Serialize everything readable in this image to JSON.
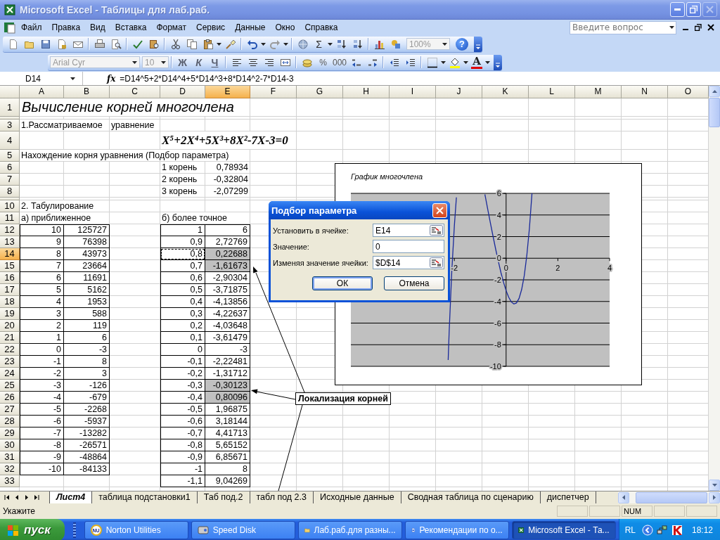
{
  "window": {
    "title": "Microsoft Excel - Таблицы для лаб.раб.",
    "controls": [
      {
        "kind": "minimize",
        "disabled": false
      },
      {
        "kind": "restore",
        "disabled": false
      },
      {
        "kind": "close",
        "disabled": true
      }
    ]
  },
  "menu": [
    "Файл",
    "Правка",
    "Вид",
    "Вставка",
    "Формат",
    "Сервис",
    "Данные",
    "Окно",
    "Справка"
  ],
  "help_box": {
    "placeholder": "Введите вопрос"
  },
  "standard_toolbar": {
    "sum": "Σ",
    "zoom": "100%",
    "help": "?"
  },
  "formatting_toolbar": {
    "font": "Arial Cyr",
    "size": "10",
    "bold": "Ж",
    "italic": "К",
    "underline": "Ч",
    "percent": "%",
    "thousands": "000",
    "font_color": "A"
  },
  "formula_bar": {
    "cell": "D14",
    "function_label": "fx",
    "formula": "=D14^5+2*D14^4+5*D14^3+8*D14^2-7*D14-3"
  },
  "sheet": {
    "columns": [
      {
        "label": "A",
        "selected": false
      },
      {
        "label": "B",
        "selected": false
      },
      {
        "label": "C",
        "selected": false
      },
      {
        "label": "D",
        "selected": false
      },
      {
        "label": "E",
        "selected": true
      },
      {
        "label": "F",
        "selected": false
      },
      {
        "label": "G",
        "selected": false
      },
      {
        "label": "H",
        "selected": false
      },
      {
        "label": "I",
        "selected": false
      },
      {
        "label": "J",
        "selected": false
      },
      {
        "label": "K",
        "selected": false
      },
      {
        "label": "L",
        "selected": false
      },
      {
        "label": "M",
        "selected": false
      },
      {
        "label": "N",
        "selected": false
      },
      {
        "label": "O",
        "selected": false
      }
    ],
    "rows": [
      {
        "header": "1",
        "kind": "tall",
        "selected": false,
        "cells": {
          "A": {
            "kind": "title",
            "text": "Вычисление корней многочлена"
          }
        }
      },
      {
        "kind": "collapsed",
        "selected": false
      },
      {
        "header": "3",
        "kind": "normal",
        "selected": false,
        "cells": {
          "A": {
            "kind": "text",
            "text": "1.Рассматриваемое"
          },
          "C": {
            "kind": "text",
            "text": "уравнение"
          }
        }
      },
      {
        "header": "4",
        "kind": "tall",
        "selected": false,
        "cells": {
          "D": {
            "kind": "equation",
            "text": "X⁵+2X⁴+5X³+8X²-7X-3=0"
          }
        }
      },
      {
        "header": "5",
        "kind": "normal",
        "selected": false,
        "cells": {
          "A": {
            "kind": "text",
            "text": "Нахождение корня уравнения (Подбор параметра)"
          }
        }
      },
      {
        "header": "6",
        "kind": "normal",
        "selected": false,
        "cells": {
          "D": {
            "kind": "text",
            "text": "1 корень"
          },
          "E": {
            "kind": "value",
            "text": "0,78934"
          }
        }
      },
      {
        "header": "7",
        "kind": "normal",
        "selected": false,
        "cells": {
          "D": {
            "kind": "text",
            "text": "2 корень"
          },
          "E": {
            "kind": "value",
            "text": "-0,32804"
          }
        }
      },
      {
        "header": "8",
        "kind": "normal",
        "selected": false,
        "cells": {
          "D": {
            "kind": "text",
            "text": "3 корень"
          },
          "E": {
            "kind": "value",
            "text": "-2,07299"
          }
        }
      },
      {
        "kind": "collapsed",
        "selected": false
      },
      {
        "header": "10",
        "kind": "normal",
        "selected": false,
        "cells": {
          "A": {
            "kind": "text",
            "text": "2. Табулирование"
          }
        }
      },
      {
        "header": "11",
        "kind": "normal",
        "selected": false,
        "cells": {
          "A": {
            "kind": "text",
            "text": "а) приближенное"
          },
          "D": {
            "kind": "text",
            "text": "б) более точное"
          }
        }
      },
      {
        "header": "12",
        "kind": "normal",
        "selected": false,
        "cells": {
          "A": {
            "kind": "table",
            "text": "10",
            "shaded": false,
            "marquee": false
          },
          "B": {
            "kind": "table",
            "text": "125727",
            "shaded": false,
            "marquee": false
          },
          "D": {
            "kind": "table",
            "text": "1",
            "shaded": false,
            "marquee": false
          },
          "E": {
            "kind": "table",
            "text": "6",
            "shaded": false,
            "marquee": false
          }
        }
      },
      {
        "header": "13",
        "kind": "normal",
        "selected": false,
        "cells": {
          "A": {
            "kind": "table",
            "text": "9",
            "shaded": false,
            "marquee": false
          },
          "B": {
            "kind": "table",
            "text": "76398",
            "shaded": false,
            "marquee": false
          },
          "D": {
            "kind": "table",
            "text": "0,9",
            "shaded": false,
            "marquee": false
          },
          "E": {
            "kind": "table",
            "text": "2,72769",
            "shaded": false,
            "marquee": false
          }
        }
      },
      {
        "header": "14",
        "kind": "normal",
        "selected": true,
        "cells": {
          "A": {
            "kind": "table",
            "text": "8",
            "shaded": false,
            "marquee": false
          },
          "B": {
            "kind": "table",
            "text": "43973",
            "shaded": false,
            "marquee": false
          },
          "D": {
            "kind": "table",
            "text": "0,8",
            "shaded": false,
            "marquee": true
          },
          "E": {
            "kind": "table",
            "text": "0,22688",
            "shaded": true,
            "marquee": false
          }
        }
      },
      {
        "header": "15",
        "kind": "normal",
        "selected": false,
        "cells": {
          "A": {
            "kind": "table",
            "text": "7",
            "shaded": false,
            "marquee": false
          },
          "B": {
            "kind": "table",
            "text": "23664",
            "shaded": false,
            "marquee": false
          },
          "D": {
            "kind": "table",
            "text": "0,7",
            "shaded": false,
            "marquee": false
          },
          "E": {
            "kind": "table",
            "text": "-1,61673",
            "shaded": true,
            "marquee": false
          }
        }
      },
      {
        "header": "16",
        "kind": "normal",
        "selected": false,
        "cells": {
          "A": {
            "kind": "table",
            "text": "6",
            "shaded": false,
            "marquee": false
          },
          "B": {
            "kind": "table",
            "text": "11691",
            "shaded": false,
            "marquee": false
          },
          "D": {
            "kind": "table",
            "text": "0,6",
            "shaded": false,
            "marquee": false
          },
          "E": {
            "kind": "table",
            "text": "-2,90304",
            "shaded": false,
            "marquee": false
          }
        }
      },
      {
        "header": "17",
        "kind": "normal",
        "selected": false,
        "cells": {
          "A": {
            "kind": "table",
            "text": "5",
            "shaded": false,
            "marquee": false
          },
          "B": {
            "kind": "table",
            "text": "5162",
            "shaded": false,
            "marquee": false
          },
          "D": {
            "kind": "table",
            "text": "0,5",
            "shaded": false,
            "marquee": false
          },
          "E": {
            "kind": "table",
            "text": "-3,71875",
            "shaded": false,
            "marquee": false
          }
        }
      },
      {
        "header": "18",
        "kind": "normal",
        "selected": false,
        "cells": {
          "A": {
            "kind": "table",
            "text": "4",
            "shaded": false,
            "marquee": false
          },
          "B": {
            "kind": "table",
            "text": "1953",
            "shaded": false,
            "marquee": false
          },
          "D": {
            "kind": "table",
            "text": "0,4",
            "shaded": false,
            "marquee": false
          },
          "E": {
            "kind": "table",
            "text": "-4,13856",
            "shaded": false,
            "marquee": false
          }
        }
      },
      {
        "header": "19",
        "kind": "normal",
        "selected": false,
        "cells": {
          "A": {
            "kind": "table",
            "text": "3",
            "shaded": false,
            "marquee": false
          },
          "B": {
            "kind": "table",
            "text": "588",
            "shaded": false,
            "marquee": false
          },
          "D": {
            "kind": "table",
            "text": "0,3",
            "shaded": false,
            "marquee": false
          },
          "E": {
            "kind": "table",
            "text": "-4,22637",
            "shaded": false,
            "marquee": false
          }
        }
      },
      {
        "header": "20",
        "kind": "normal",
        "selected": false,
        "cells": {
          "A": {
            "kind": "table",
            "text": "2",
            "shaded": false,
            "marquee": false
          },
          "B": {
            "kind": "table",
            "text": "119",
            "shaded": false,
            "marquee": false
          },
          "D": {
            "kind": "table",
            "text": "0,2",
            "shaded": false,
            "marquee": false
          },
          "E": {
            "kind": "table",
            "text": "-4,03648",
            "shaded": false,
            "marquee": false
          }
        }
      },
      {
        "header": "21",
        "kind": "normal",
        "selected": false,
        "cells": {
          "A": {
            "kind": "table",
            "text": "1",
            "shaded": false,
            "marquee": false
          },
          "B": {
            "kind": "table",
            "text": "6",
            "shaded": false,
            "marquee": false
          },
          "D": {
            "kind": "table",
            "text": "0,1",
            "shaded": false,
            "marquee": false
          },
          "E": {
            "kind": "table",
            "text": "-3,61479",
            "shaded": false,
            "marquee": false
          }
        }
      },
      {
        "header": "22",
        "kind": "normal",
        "selected": false,
        "cells": {
          "A": {
            "kind": "table",
            "text": "0",
            "shaded": false,
            "marquee": false
          },
          "B": {
            "kind": "table",
            "text": "-3",
            "shaded": false,
            "marquee": false
          },
          "D": {
            "kind": "table",
            "text": "0",
            "shaded": false,
            "marquee": false
          },
          "E": {
            "kind": "table",
            "text": "-3",
            "shaded": false,
            "marquee": false
          }
        }
      },
      {
        "header": "23",
        "kind": "normal",
        "selected": false,
        "cells": {
          "A": {
            "kind": "table",
            "text": "-1",
            "shaded": false,
            "marquee": false
          },
          "B": {
            "kind": "table",
            "text": "8",
            "shaded": false,
            "marquee": false
          },
          "D": {
            "kind": "table",
            "text": "-0,1",
            "shaded": false,
            "marquee": false
          },
          "E": {
            "kind": "table",
            "text": "-2,22481",
            "shaded": false,
            "marquee": false
          }
        }
      },
      {
        "header": "24",
        "kind": "normal",
        "selected": false,
        "cells": {
          "A": {
            "kind": "table",
            "text": "-2",
            "shaded": false,
            "marquee": false
          },
          "B": {
            "kind": "table",
            "text": "3",
            "shaded": false,
            "marquee": false
          },
          "D": {
            "kind": "table",
            "text": "-0,2",
            "shaded": false,
            "marquee": false
          },
          "E": {
            "kind": "table",
            "text": "-1,31712",
            "shaded": false,
            "marquee": false
          }
        }
      },
      {
        "header": "25",
        "kind": "normal",
        "selected": false,
        "cells": {
          "A": {
            "kind": "table",
            "text": "-3",
            "shaded": false,
            "marquee": false
          },
          "B": {
            "kind": "table",
            "text": "-126",
            "shaded": false,
            "marquee": false
          },
          "D": {
            "kind": "table",
            "text": "-0,3",
            "shaded": false,
            "marquee": false
          },
          "E": {
            "kind": "table",
            "text": "-0,30123",
            "shaded": true,
            "marquee": false
          }
        }
      },
      {
        "header": "26",
        "kind": "normal",
        "selected": false,
        "cells": {
          "A": {
            "kind": "table",
            "text": "-4",
            "shaded": false,
            "marquee": false
          },
          "B": {
            "kind": "table",
            "text": "-679",
            "shaded": false,
            "marquee": false
          },
          "D": {
            "kind": "table",
            "text": "-0,4",
            "shaded": false,
            "marquee": false
          },
          "E": {
            "kind": "table",
            "text": "0,80096",
            "shaded": true,
            "marquee": false
          }
        }
      },
      {
        "header": "27",
        "kind": "normal",
        "selected": false,
        "cells": {
          "A": {
            "kind": "table",
            "text": "-5",
            "shaded": false,
            "marquee": false
          },
          "B": {
            "kind": "table",
            "text": "-2268",
            "shaded": false,
            "marquee": false
          },
          "D": {
            "kind": "table",
            "text": "-0,5",
            "shaded": false,
            "marquee": false
          },
          "E": {
            "kind": "table",
            "text": "1,96875",
            "shaded": false,
            "marquee": false
          }
        }
      },
      {
        "header": "28",
        "kind": "normal",
        "selected": false,
        "cells": {
          "A": {
            "kind": "table",
            "text": "-6",
            "shaded": false,
            "marquee": false
          },
          "B": {
            "kind": "table",
            "text": "-5937",
            "shaded": false,
            "marquee": false
          },
          "D": {
            "kind": "table",
            "text": "-0,6",
            "shaded": false,
            "marquee": false
          },
          "E": {
            "kind": "table",
            "text": "3,18144",
            "shaded": false,
            "marquee": false
          }
        }
      },
      {
        "header": "29",
        "kind": "normal",
        "selected": false,
        "cells": {
          "A": {
            "kind": "table",
            "text": "-7",
            "shaded": false,
            "marquee": false
          },
          "B": {
            "kind": "table",
            "text": "-13282",
            "shaded": false,
            "marquee": false
          },
          "D": {
            "kind": "table",
            "text": "-0,7",
            "shaded": false,
            "marquee": false
          },
          "E": {
            "kind": "table",
            "text": "4,41713",
            "shaded": false,
            "marquee": false
          }
        }
      },
      {
        "header": "30",
        "kind": "normal",
        "selected": false,
        "cells": {
          "A": {
            "kind": "table",
            "text": "-8",
            "shaded": false,
            "marquee": false
          },
          "B": {
            "kind": "table",
            "text": "-26571",
            "shaded": false,
            "marquee": false
          },
          "D": {
            "kind": "table",
            "text": "-0,8",
            "shaded": false,
            "marquee": false
          },
          "E": {
            "kind": "table",
            "text": "5,65152",
            "shaded": false,
            "marquee": false
          }
        }
      },
      {
        "header": "31",
        "kind": "normal",
        "selected": false,
        "cells": {
          "A": {
            "kind": "table",
            "text": "-9",
            "shaded": false,
            "marquee": false
          },
          "B": {
            "kind": "table",
            "text": "-48864",
            "shaded": false,
            "marquee": false
          },
          "D": {
            "kind": "table",
            "text": "-0,9",
            "shaded": false,
            "marquee": false
          },
          "E": {
            "kind": "table",
            "text": "6,85671",
            "shaded": false,
            "marquee": false
          }
        }
      },
      {
        "header": "32",
        "kind": "normal",
        "selected": false,
        "cells": {
          "A": {
            "kind": "table",
            "text": "-10",
            "shaded": false,
            "marquee": false
          },
          "B": {
            "kind": "table",
            "text": "-84133",
            "shaded": false,
            "marquee": false
          },
          "D": {
            "kind": "table",
            "text": "-1",
            "shaded": false,
            "marquee": false
          },
          "E": {
            "kind": "table",
            "text": "8",
            "shaded": false,
            "marquee": false
          }
        }
      },
      {
        "header": "33",
        "kind": "normal",
        "selected": false,
        "cells": {
          "D": {
            "kind": "table",
            "text": "-1,1",
            "shaded": false,
            "marquee": false
          },
          "E": {
            "kind": "table",
            "text": "9,04269",
            "shaded": false,
            "marquee": false
          }
        }
      }
    ]
  },
  "chart": {
    "chart_data": {
      "type": "line",
      "title": "График многочлена",
      "grid": true,
      "x": [
        -2.24,
        -2.2,
        -2.1,
        -2,
        -1.92,
        -1.4,
        -0.82,
        -0.8,
        -0.7,
        -0.6,
        -0.5,
        -0.4,
        -0.3,
        -0.2,
        -0.1,
        0,
        0.1,
        0.2,
        0.3,
        0.4,
        0.5,
        0.6,
        0.7,
        0.8,
        0.9,
        1
      ],
      "series": [
        {
          "color": "#1a2a9a",
          "values": [
            -9.42,
            -6.81,
            -1.27,
            3,
            5.63,
            null,
            5.9,
            5.65,
            4.42,
            3.18,
            1.97,
            0.8,
            -0.3,
            -1.32,
            -2.22,
            -3,
            -3.61,
            -4.04,
            -4.23,
            -4.14,
            -3.72,
            -2.9,
            -1.62,
            0.23,
            2.73,
            6
          ]
        }
      ],
      "xlim": [
        -6,
        4
      ],
      "ylim": [
        -10,
        6
      ],
      "xticks": [
        {
          "value": -2,
          "label": "-2"
        },
        {
          "value": 0,
          "label": "0"
        },
        {
          "value": 2,
          "label": "2"
        },
        {
          "value": 4,
          "label": "4"
        }
      ],
      "yticks": [
        {
          "value": 6,
          "label": "6"
        },
        {
          "value": 4,
          "label": "4"
        },
        {
          "value": 2,
          "label": "2"
        },
        {
          "value": 0,
          "label": "0"
        },
        {
          "value": -2,
          "label": "-2"
        },
        {
          "value": -4,
          "label": "-4"
        },
        {
          "value": -6,
          "label": "-6"
        },
        {
          "value": -8,
          "label": "-8"
        },
        {
          "value": -10,
          "label": "-10"
        }
      ]
    }
  },
  "dialog": {
    "title": "Подбор параметра",
    "fields": [
      {
        "label": "Установить в ячейке:",
        "value": "E14",
        "kind": "reference"
      },
      {
        "label": "Значение:",
        "value": "0",
        "kind": "plain"
      },
      {
        "label": "Изменяя значение ячейки:",
        "value": "$D$14",
        "kind": "reference"
      }
    ],
    "buttons": [
      {
        "label": "ОК",
        "default": true
      },
      {
        "label": "Отмена",
        "default": false
      }
    ]
  },
  "callout": {
    "label": "Локализация корней"
  },
  "sheet_tabs": [
    {
      "label": "Лист4",
      "selected": true
    },
    {
      "label": "таблица подстановки1",
      "selected": false
    },
    {
      "label": "Таб под.2",
      "selected": false
    },
    {
      "label": "табл под 2.3",
      "selected": false
    },
    {
      "label": "Исходные данные",
      "selected": false
    },
    {
      "label": "Сводная таблица по сценарию",
      "selected": false
    },
    {
      "label": "диспетчер",
      "selected": false
    }
  ],
  "status_bar": {
    "message": "Укажите",
    "indicator": "NUM"
  },
  "taskbar": {
    "start": "пуск",
    "items": [
      {
        "label": "Norton Utilities",
        "kind": "badge",
        "badge": "NU",
        "selected": false
      },
      {
        "label": "Speed Disk",
        "kind": "disk",
        "selected": false
      },
      {
        "label": "Лаб.раб.для разны...",
        "kind": "folder",
        "selected": false
      },
      {
        "label": "Рекомендации по о...",
        "kind": "document",
        "selected": false
      },
      {
        "label": "Microsoft Excel - Та...",
        "kind": "spreadsheet",
        "selected": true
      }
    ],
    "language": "RL",
    "clock": "18:12"
  }
}
